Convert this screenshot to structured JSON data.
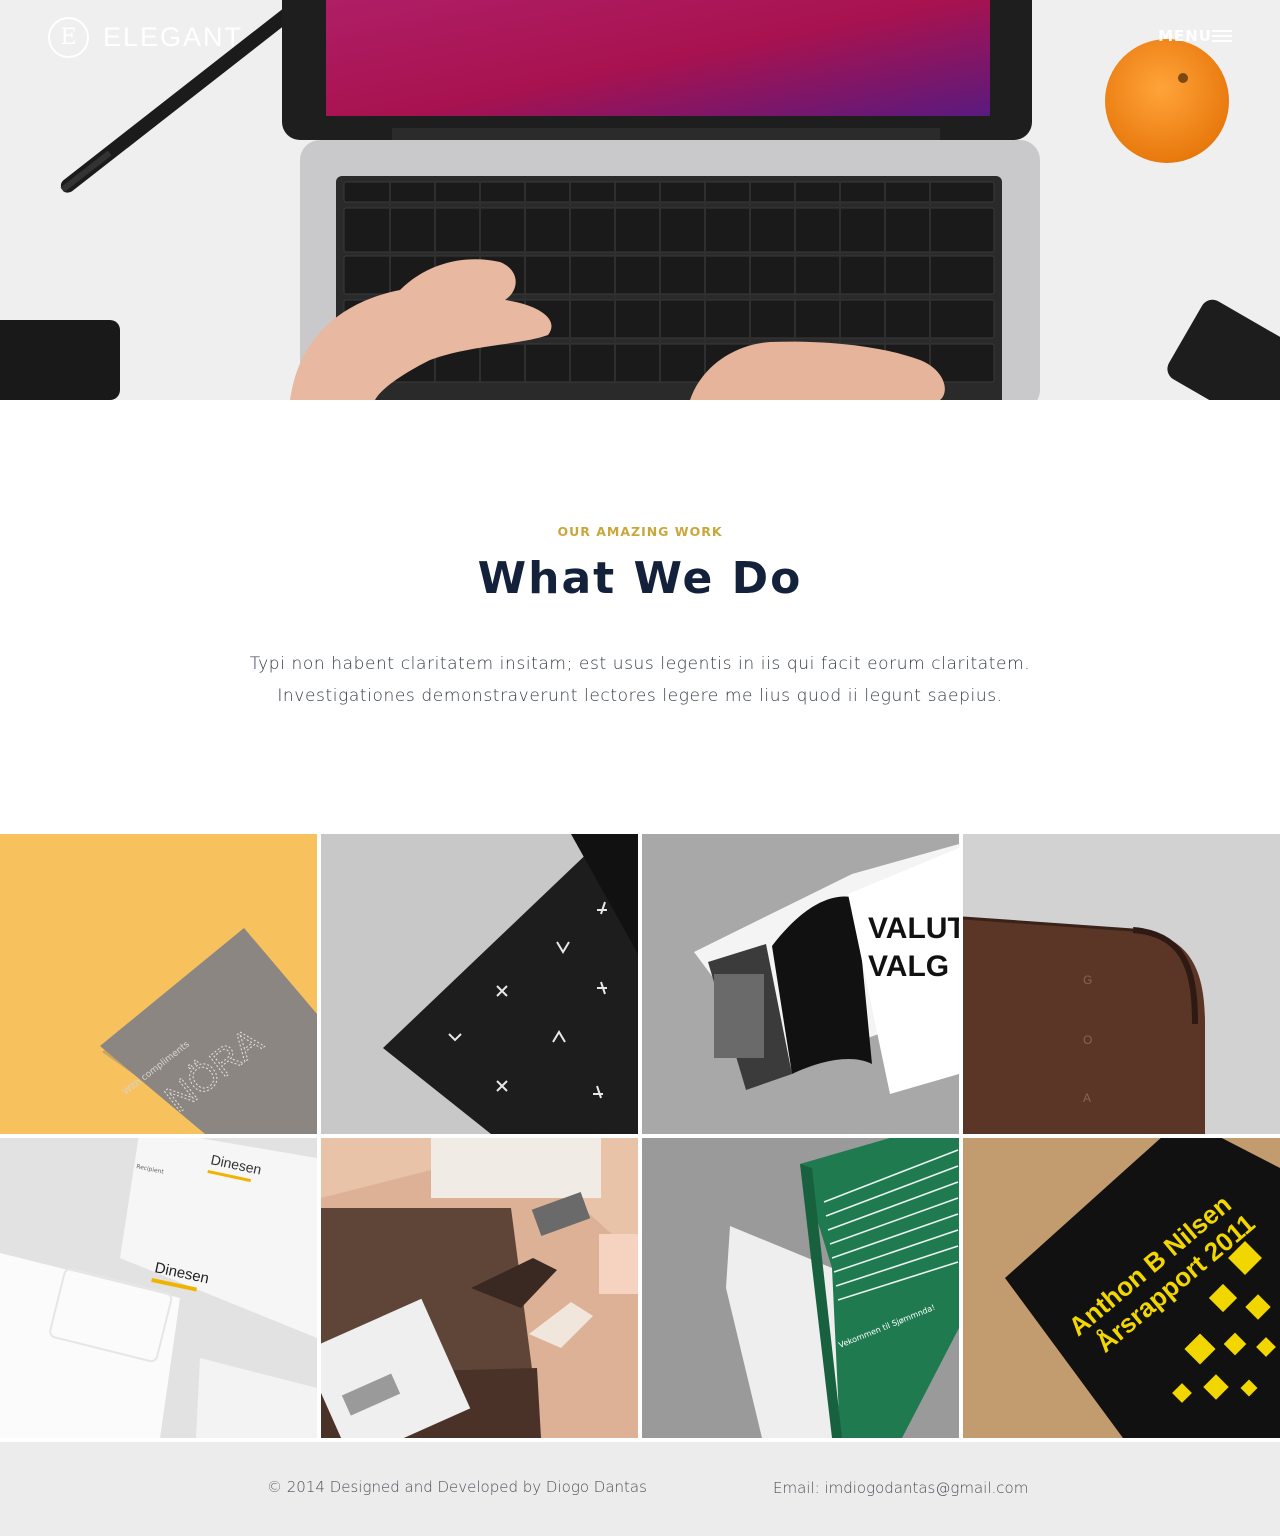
{
  "brand": {
    "name": "ELEGANT",
    "monogram": "E"
  },
  "nav": {
    "menu_label": "MENU",
    "menu_icon": "hamburger-icon"
  },
  "hero": {
    "image": "laptop-typing-photo"
  },
  "section": {
    "eyebrow": "OUR AMAZING WORK",
    "title": "What We Do",
    "lead_line1": "Typi non habent claritatem insitam; est usus legentis in iis qui facit eorum claritatem.",
    "lead_line2": "Investigationes demonstraverunt lectores legere me lius quod ii legunt saepius."
  },
  "portfolio": {
    "items": [
      {
        "image": "nora-compliment-card",
        "card_label": "With compliments",
        "card_wordmark": "NÖRA"
      },
      {
        "image": "black-pattern-print"
      },
      {
        "image": "valut-valg-brochure",
        "headline_top": "VALUT",
        "headline_bottom": "VALG"
      },
      {
        "image": "brown-leather-wrap"
      },
      {
        "image": "dinesen-stationery",
        "brand": "Dinesen",
        "recipient": "Recipient"
      },
      {
        "image": "brown-folder-stationery"
      },
      {
        "image": "green-booklet",
        "caption": "Vekommen til Sjømmnda!"
      },
      {
        "image": "arsrapport-cover",
        "line1": "Anthon B Nilsen",
        "line2": "Årsrapport 2011"
      }
    ]
  },
  "footer": {
    "copyright": "© 2014 Designed and Developed by Diogo Dantas",
    "email": "Email: imdiogodantas@gmail.com"
  },
  "colors": {
    "accent": "#c9a73a",
    "heading": "#14213a",
    "footer_bg": "#ececec"
  }
}
